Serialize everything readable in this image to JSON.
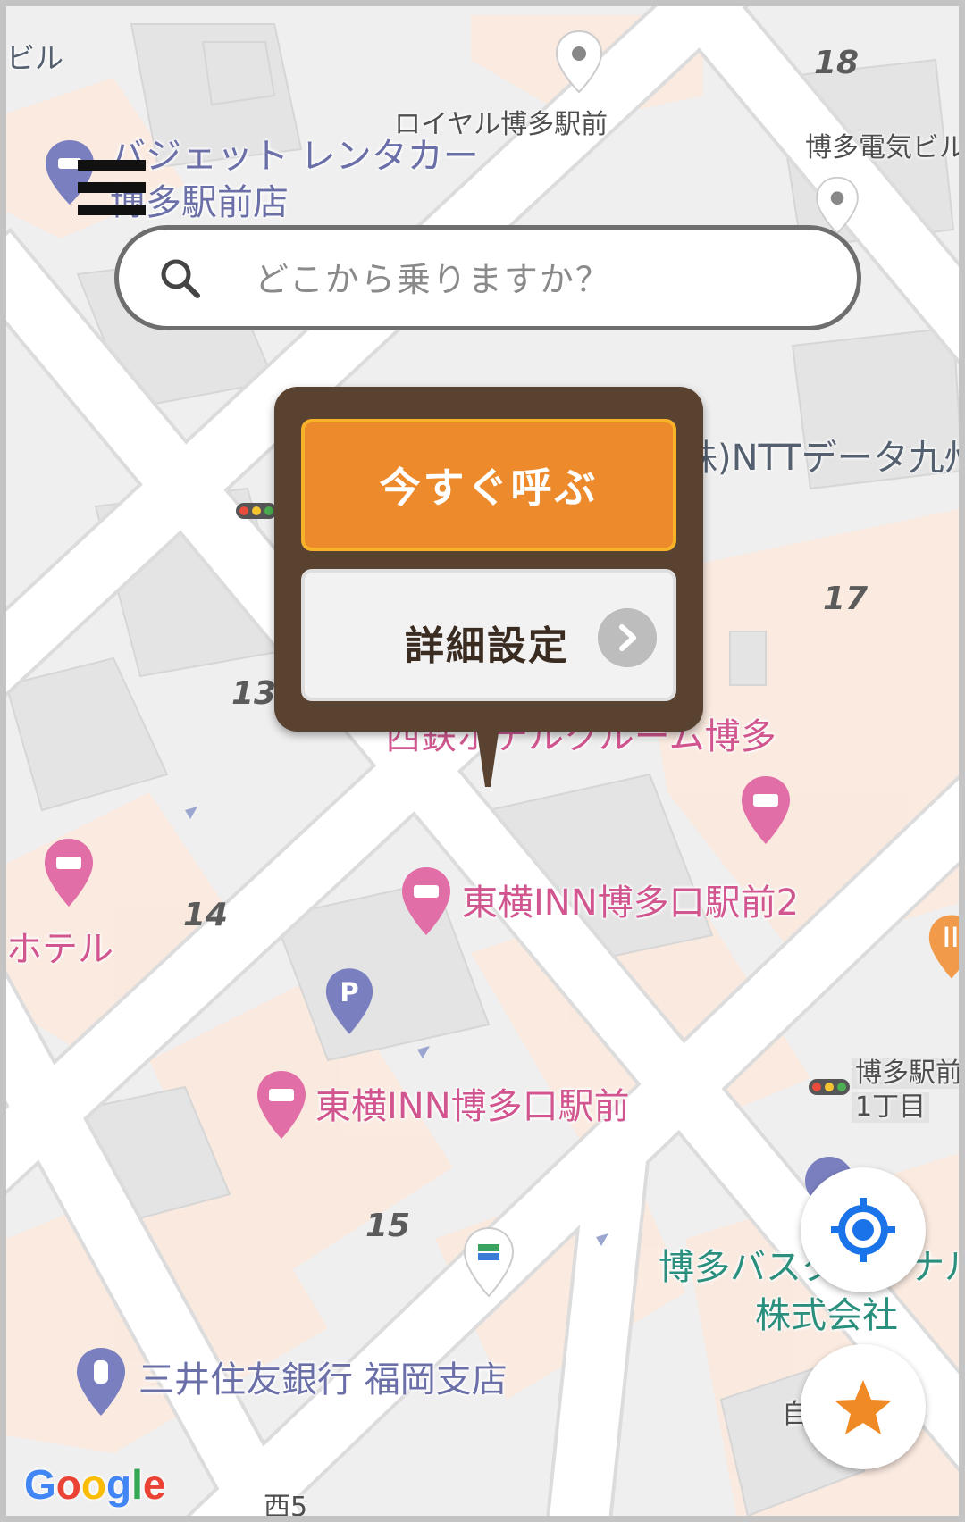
{
  "search": {
    "placeholder": "どこから乗りますか？"
  },
  "popup": {
    "call_now_label": "今すぐ呼ぶ",
    "detail_settings_label": "詳細設定"
  },
  "map": {
    "labels": {
      "building_left_top": "ビル",
      "royal_hakata": "ロイヤル博多駅前",
      "budget_rental_line1": "バジェット レンタカー",
      "budget_rental_line2": "博多駅前店",
      "hakata_denki": "博多電気ビル",
      "ntt_data": "株)NTTデータ九州",
      "nishitetsu_hotel": "西鉄ホテルクルーム博多",
      "toyoko_inn_2": "東横INN博多口駅前2",
      "toyoko_inn": "東横INN博多口駅前",
      "hotel_left": "ホテル",
      "hakata_ekimae_1": "博多駅前",
      "hakata_ekimae_2": "1丁目",
      "bus_terminal_line1": "博多バスターミナル",
      "bus_terminal_line2": "株式会社",
      "mitsui_bank": "三井住友銀行 福岡支店",
      "nishi5": "西5",
      "partial_char": "自"
    },
    "block_numbers": {
      "b18": "18",
      "b17": "17",
      "b13": "13",
      "b14": "14",
      "b15": "15"
    }
  },
  "icons": {
    "menu": "menu-icon",
    "search": "search-icon",
    "locate": "my-location-icon",
    "favorite": "star-icon",
    "chevron": "chevron-right-icon"
  },
  "colors": {
    "accent": "#ed8a2b",
    "popup_bg": "#5a4231",
    "locate_icon": "#1a73e8",
    "star": "#f08a24"
  },
  "google_logo": "Google"
}
